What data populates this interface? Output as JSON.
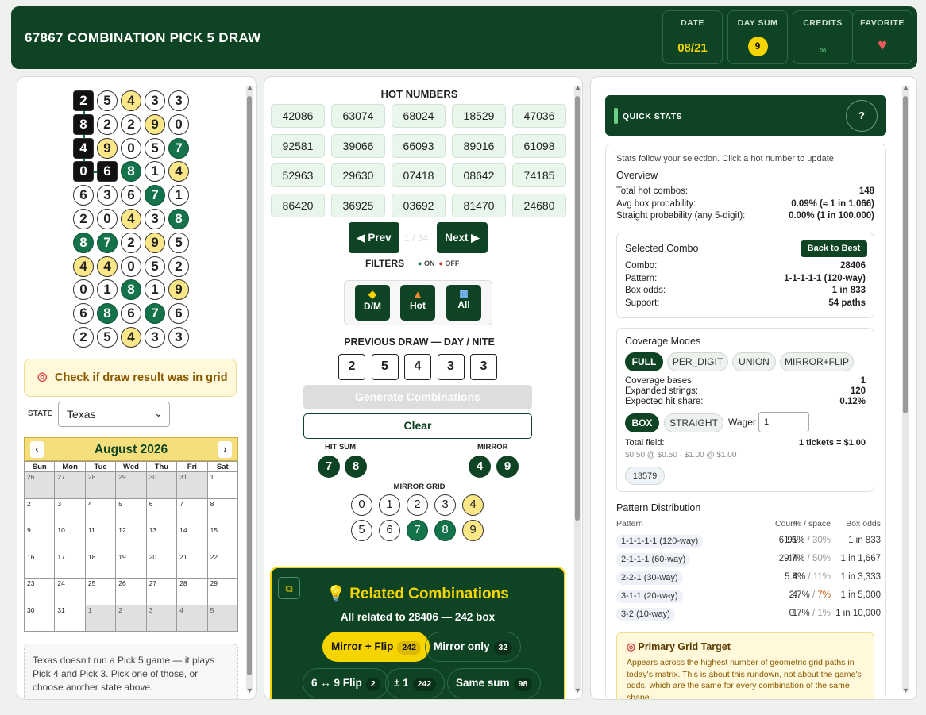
{
  "header": {
    "title": "67867 COMBINATION PICK 5 DRAW",
    "stats": [
      {
        "label": "DATE",
        "value": "08/21"
      },
      {
        "label": "DAY SUM",
        "value": "9"
      },
      {
        "label": "CREDITS",
        "value": "∞"
      },
      {
        "label": "FAVORITE",
        "icon": "heart-icon"
      }
    ]
  },
  "grid": [
    [
      {
        "d": "2",
        "s": "b"
      },
      {
        "d": "5",
        "s": ""
      },
      {
        "d": "4",
        "s": "y"
      },
      {
        "d": "3",
        "s": ""
      },
      {
        "d": "3",
        "s": ""
      }
    ],
    [
      {
        "d": "8",
        "s": "b"
      },
      {
        "d": "2",
        "s": ""
      },
      {
        "d": "2",
        "s": ""
      },
      {
        "d": "9",
        "s": "y"
      },
      {
        "d": "0",
        "s": ""
      }
    ],
    [
      {
        "d": "4",
        "s": "b"
      },
      {
        "d": "9",
        "s": "y"
      },
      {
        "d": "0",
        "s": ""
      },
      {
        "d": "5",
        "s": ""
      },
      {
        "d": "7",
        "s": "g"
      }
    ],
    [
      {
        "d": "0",
        "s": "b"
      },
      {
        "d": "6",
        "s": "b"
      },
      {
        "d": "8",
        "s": "g"
      },
      {
        "d": "1",
        "s": ""
      },
      {
        "d": "4",
        "s": "y"
      }
    ],
    [
      {
        "d": "6",
        "s": ""
      },
      {
        "d": "3",
        "s": ""
      },
      {
        "d": "6",
        "s": ""
      },
      {
        "d": "7",
        "s": "g"
      },
      {
        "d": "1",
        "s": ""
      }
    ],
    [
      {
        "d": "2",
        "s": ""
      },
      {
        "d": "0",
        "s": ""
      },
      {
        "d": "4",
        "s": "y"
      },
      {
        "d": "3",
        "s": ""
      },
      {
        "d": "8",
        "s": "g"
      }
    ],
    [
      {
        "d": "8",
        "s": "g"
      },
      {
        "d": "7",
        "s": "g"
      },
      {
        "d": "2",
        "s": ""
      },
      {
        "d": "9",
        "s": "y"
      },
      {
        "d": "5",
        "s": ""
      }
    ],
    [
      {
        "d": "4",
        "s": "y"
      },
      {
        "d": "4",
        "s": "y"
      },
      {
        "d": "0",
        "s": ""
      },
      {
        "d": "5",
        "s": ""
      },
      {
        "d": "2",
        "s": ""
      }
    ],
    [
      {
        "d": "0",
        "s": ""
      },
      {
        "d": "1",
        "s": ""
      },
      {
        "d": "8",
        "s": "g"
      },
      {
        "d": "1",
        "s": ""
      },
      {
        "d": "9",
        "s": "y"
      }
    ],
    [
      {
        "d": "6",
        "s": ""
      },
      {
        "d": "8",
        "s": "g"
      },
      {
        "d": "6",
        "s": ""
      },
      {
        "d": "7",
        "s": "g"
      },
      {
        "d": "6",
        "s": ""
      }
    ],
    [
      {
        "d": "2",
        "s": ""
      },
      {
        "d": "5",
        "s": ""
      },
      {
        "d": "4",
        "s": "y"
      },
      {
        "d": "3",
        "s": ""
      },
      {
        "d": "3",
        "s": ""
      }
    ]
  ],
  "left": {
    "check_label": "Check if draw result was in grid",
    "state_label": "STATE",
    "state_value": "Texas",
    "calendar": {
      "month": "August 2026",
      "days": [
        "Sun",
        "Mon",
        "Tue",
        "Wed",
        "Thu",
        "Fri",
        "Sat"
      ],
      "cells": [
        "26",
        "27",
        "28",
        "29",
        "30",
        "31",
        "1",
        "2",
        "3",
        "4",
        "5",
        "6",
        "7",
        "8",
        "9",
        "10",
        "11",
        "12",
        "13",
        "14",
        "15",
        "16",
        "17",
        "18",
        "19",
        "20",
        "21",
        "22",
        "23",
        "24",
        "25",
        "26",
        "27",
        "28",
        "29",
        "30",
        "31",
        "1",
        "2",
        "3",
        "4",
        "5"
      ]
    },
    "note": "Texas doesn't run a Pick 5 game — it plays Pick 4 and Pick 3. Pick one of those, or choose another state above."
  },
  "middle": {
    "hot_title": "HOT NUMBERS",
    "hot": [
      "42086",
      "63074",
      "68024",
      "18529",
      "47036",
      "92581",
      "39066",
      "66093",
      "89016",
      "61098",
      "52963",
      "29630",
      "07418",
      "08642",
      "74185",
      "86420",
      "36925",
      "03692",
      "81470",
      "24680"
    ],
    "prev": "◀ Prev",
    "page": "1 / 34",
    "next": "Next ▶",
    "filters": "FILTERS",
    "on": "ON",
    "off": "OFF",
    "filter_btns": [
      {
        "icon": "diamond-icon",
        "label": "D/M"
      },
      {
        "icon": "fire-icon",
        "label": "Hot"
      },
      {
        "icon": "calendar-icon",
        "label": "All"
      }
    ],
    "prev_draw_title": "PREVIOUS DRAW — DAY / NITE",
    "prev_draw": [
      "2",
      "5",
      "4",
      "3",
      "3"
    ],
    "generate": "Generate Combinations",
    "clear": "Clear",
    "hit_sum_label": "HIT SUM",
    "hit_sum": [
      "7",
      "8"
    ],
    "mirror_label": "MIRROR",
    "mirror": [
      "4",
      "9"
    ],
    "mirror_grid_label": "MIRROR GRID",
    "mirror_grid": [
      {
        "d": "0",
        "s": ""
      },
      {
        "d": "1",
        "s": ""
      },
      {
        "d": "2",
        "s": ""
      },
      {
        "d": "3",
        "s": ""
      },
      {
        "d": "4",
        "s": "y"
      },
      {
        "d": "5",
        "s": ""
      },
      {
        "d": "6",
        "s": ""
      },
      {
        "d": "7",
        "s": "g"
      },
      {
        "d": "8",
        "s": "g"
      },
      {
        "d": "9",
        "s": "y"
      }
    ],
    "related": {
      "title": "Related Combinations",
      "subtitle": "All related to 28406 — 242 box",
      "pills": [
        {
          "label": "Mirror + Flip",
          "count": "242"
        },
        {
          "label": "Mirror only",
          "count": "32"
        },
        {
          "label": "6 ↔ 9 Flip",
          "count": "2"
        },
        {
          "label": "± 1",
          "count": "242"
        },
        {
          "label": "Same sum",
          "count": "98"
        }
      ]
    }
  },
  "right": {
    "title": "QUICK STATS",
    "help": "?",
    "intro": "Stats follow your selection. Click a hot number to update.",
    "overview_title": "Overview",
    "overview": [
      {
        "k": "Total hot combos:",
        "v": "148"
      },
      {
        "k": "Avg box probability:",
        "v": "0.09% (≈ 1 in 1,066)"
      },
      {
        "k": "Straight probability (any 5-digit):",
        "v": "0.00% (1 in 100,000)"
      }
    ],
    "selected_title": "Selected Combo",
    "back_btn": "Back to Best",
    "selected": [
      {
        "k": "Combo:",
        "v": "28406"
      },
      {
        "k": "Pattern:",
        "v": "1-1-1-1-1 (120-way)"
      },
      {
        "k": "Box odds:",
        "v": "1 in 833"
      },
      {
        "k": "Support:",
        "v": "54 paths"
      }
    ],
    "coverage_title": "Coverage Modes",
    "modes": [
      "FULL",
      "PER_DIGIT",
      "UNION",
      "MIRROR+FLIP"
    ],
    "coverage": [
      {
        "k": "Coverage bases:",
        "v": "1"
      },
      {
        "k": "Expanded strings:",
        "v": "120"
      },
      {
        "k": "Expected hit share:",
        "v": "0.12%"
      }
    ],
    "play": [
      "BOX",
      "STRAIGHT"
    ],
    "wager_label": "Wager",
    "wager_value": "1",
    "total_field_label": "Total field:",
    "total_field_value": "1 tickets = $1.00",
    "price_note": "$0.50 @ $0.50 · $1.00 @ $1.00",
    "combo_tag": "13579",
    "dist_title": "Pattern Distribution",
    "dist_cols": [
      "Pattern",
      "Count",
      "% / space",
      "Box odds"
    ],
    "dist": [
      {
        "p": "1-1-1-1-1 (120-way)",
        "c": "91",
        "pct": "61.5%",
        "sp": "30%",
        "o": "1 in 833"
      },
      {
        "p": "2-1-1-1 (60-way)",
        "c": "44",
        "pct": "29.7%",
        "sp": "50%",
        "o": "1 in 1,667"
      },
      {
        "p": "2-2-1 (30-way)",
        "c": "8",
        "pct": "5.4%",
        "sp": "11%",
        "o": "1 in 3,333"
      },
      {
        "p": "3-1-1 (20-way)",
        "c": "4",
        "pct": "2.7%",
        "sp": "7%",
        "o": "1 in 5,000"
      },
      {
        "p": "3-2 (10-way)",
        "c": "1",
        "pct": "0.7%",
        "sp": "1%",
        "o": "1 in 10,000"
      }
    ],
    "target_title": "Primary Grid Target",
    "target_text": "Appears across the highest number of geometric grid paths in today's matrix. This is about this rundown, not about the game's odds, which are the same for every combination of the same shape."
  }
}
